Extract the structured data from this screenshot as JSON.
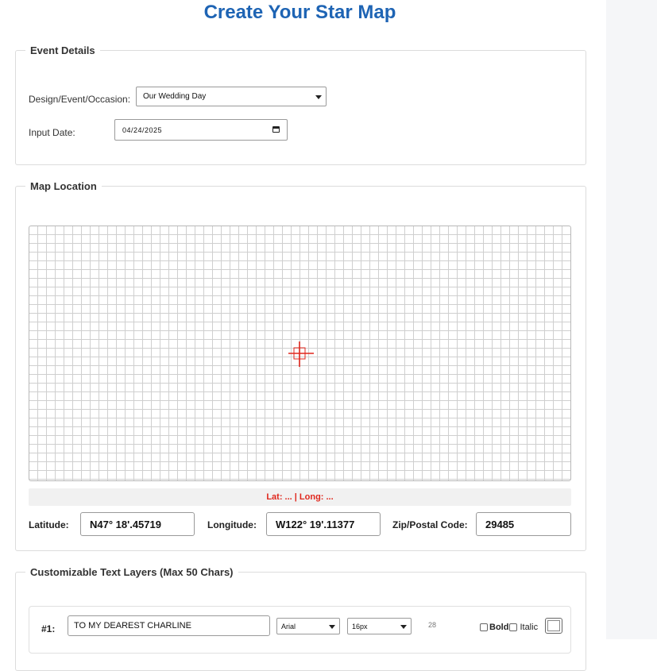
{
  "page": {
    "title": "Create Your Star Map"
  },
  "event_details": {
    "legend": "Event Details",
    "occasion_label": "Design/Event/Occasion:",
    "occasion_value": "Our Wedding Day",
    "date_label": "Input Date:",
    "date_value": "04/24/2025"
  },
  "map_location": {
    "legend": "Map Location",
    "coords_readout": "Lat: ... | Long: ...",
    "latitude_label": "Latitude:",
    "latitude_value": "N47° 18'.45719",
    "longitude_label": "Longitude:",
    "longitude_value": "W122° 19'.11377",
    "zip_label": "Zip/Postal Code:",
    "zip_value": "29485",
    "crosshair_color": "#e0271d"
  },
  "text_layers": {
    "legend": "Customizable Text Layers (Max 50 Chars)",
    "layers": [
      {
        "number_label": "#1:",
        "text": "TO MY DEAREST CHARLINE",
        "font": "Arial",
        "size": "16px",
        "char_count": "28",
        "bold_label": "Bold",
        "italic_label": "Italic"
      }
    ]
  },
  "colors": {
    "title": "#1e64b4",
    "accent_red": "#e0271d"
  }
}
